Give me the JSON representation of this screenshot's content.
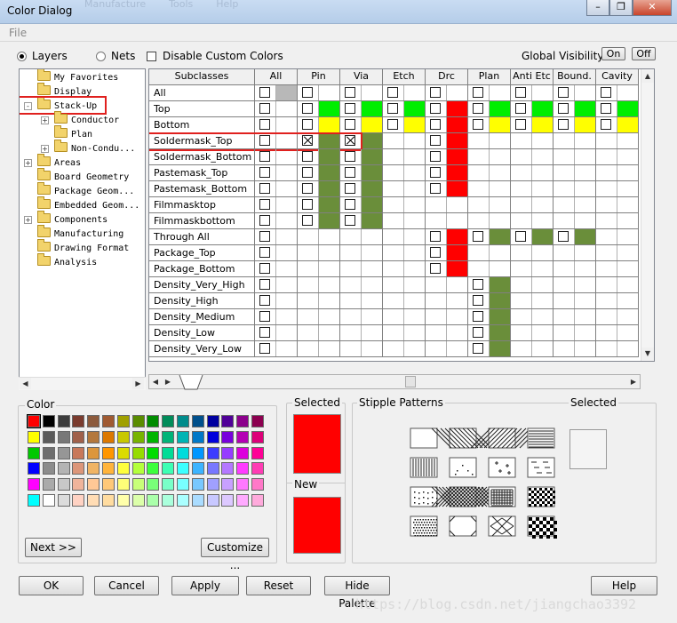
{
  "window": {
    "title": "Color Dialog",
    "ghost_menu": [
      "Manufacture",
      "Tools",
      "Help"
    ],
    "controls": [
      "minimize-icon",
      "restore-icon",
      "close-icon"
    ]
  },
  "menu": {
    "file": "File"
  },
  "options": {
    "layers_label": "Layers",
    "layers_selected": true,
    "nets_label": "Nets",
    "nets_selected": false,
    "disable_custom_label": "Disable Custom Colors",
    "disable_custom_checked": false,
    "global_visibility_label": "Global Visibility:",
    "on_label": "On",
    "off_label": "Off"
  },
  "tree": [
    {
      "label": "My Favorites",
      "level": 0,
      "expander": "",
      "highlighted": false
    },
    {
      "label": "Display",
      "level": 0,
      "expander": "",
      "highlighted": false
    },
    {
      "label": "Stack-Up",
      "level": 0,
      "expander": "-",
      "highlighted": true
    },
    {
      "label": "Conductor",
      "level": 1,
      "expander": "+",
      "highlighted": false
    },
    {
      "label": "Plan",
      "level": 1,
      "expander": "",
      "highlighted": false
    },
    {
      "label": "Non-Condu...",
      "level": 1,
      "expander": "+",
      "highlighted": false
    },
    {
      "label": "Areas",
      "level": 0,
      "expander": "+",
      "highlighted": false
    },
    {
      "label": "Board Geometry",
      "level": 0,
      "expander": "",
      "highlighted": false
    },
    {
      "label": "Package Geom...",
      "level": 0,
      "expander": "",
      "highlighted": false
    },
    {
      "label": "Embedded Geom...",
      "level": 0,
      "expander": "",
      "highlighted": false
    },
    {
      "label": "Components",
      "level": 0,
      "expander": "+",
      "highlighted": false
    },
    {
      "label": "Manufacturing",
      "level": 0,
      "expander": "",
      "highlighted": false
    },
    {
      "label": "Drawing Format",
      "level": 0,
      "expander": "",
      "highlighted": false
    },
    {
      "label": "Analysis",
      "level": 0,
      "expander": "",
      "highlighted": false
    }
  ],
  "grid": {
    "subclass_header": "Subclasses",
    "columns": [
      "All",
      "Pin",
      "Via",
      "Etch",
      "Drc",
      "Plan",
      "Anti Etc",
      "Bound.",
      "Cavity"
    ],
    "highlighted_row": "Soldermask_Top",
    "rows": [
      {
        "name": "All",
        "cells": [
          {
            "chk": true,
            "color": "#b8b8b8"
          },
          {
            "chk": true,
            "color": ""
          },
          {
            "chk": true,
            "color": ""
          },
          {
            "chk": true,
            "color": ""
          },
          {
            "chk": true,
            "color": ""
          },
          {
            "chk": true,
            "color": ""
          },
          {
            "chk": true,
            "color": ""
          },
          {
            "chk": true,
            "color": ""
          },
          {
            "chk": true,
            "color": ""
          }
        ]
      },
      {
        "name": "Top",
        "cells": [
          {
            "chk": true,
            "color": ""
          },
          {
            "chk": true,
            "color": "#00ee00"
          },
          {
            "chk": true,
            "color": "#00ee00"
          },
          {
            "chk": true,
            "color": "#00ee00"
          },
          {
            "chk": true,
            "color": "#ff0000"
          },
          {
            "chk": true,
            "color": "#00ee00"
          },
          {
            "chk": true,
            "color": "#00ee00"
          },
          {
            "chk": true,
            "color": "#00ee00"
          },
          {
            "chk": true,
            "color": "#00ee00"
          }
        ]
      },
      {
        "name": "Bottom",
        "cells": [
          {
            "chk": true,
            "color": ""
          },
          {
            "chk": true,
            "color": "#ffff00"
          },
          {
            "chk": true,
            "color": "#ffff00"
          },
          {
            "chk": true,
            "color": "#ffff00"
          },
          {
            "chk": true,
            "color": "#ff0000"
          },
          {
            "chk": true,
            "color": "#ffff00"
          },
          {
            "chk": true,
            "color": "#ffff00"
          },
          {
            "chk": true,
            "color": "#ffff00"
          },
          {
            "chk": true,
            "color": "#ffff00"
          }
        ]
      },
      {
        "name": "Soldermask_Top",
        "cells": [
          {
            "chk": true,
            "color": ""
          },
          {
            "chk": "x",
            "color": "#6a8e3a"
          },
          {
            "chk": "x",
            "color": "#6a8e3a"
          },
          {
            "chk": false,
            "color": ""
          },
          {
            "chk": true,
            "color": "#ff0000"
          },
          {
            "chk": false,
            "color": ""
          },
          {
            "chk": false,
            "color": ""
          },
          {
            "chk": false,
            "color": ""
          },
          {
            "chk": false,
            "color": ""
          }
        ]
      },
      {
        "name": "Soldermask_Bottom",
        "cells": [
          {
            "chk": true,
            "color": ""
          },
          {
            "chk": true,
            "color": "#6a8e3a"
          },
          {
            "chk": true,
            "color": "#6a8e3a"
          },
          {
            "chk": false,
            "color": ""
          },
          {
            "chk": true,
            "color": "#ff0000"
          },
          {
            "chk": false,
            "color": ""
          },
          {
            "chk": false,
            "color": ""
          },
          {
            "chk": false,
            "color": ""
          },
          {
            "chk": false,
            "color": ""
          }
        ]
      },
      {
        "name": "Pastemask_Top",
        "cells": [
          {
            "chk": true,
            "color": ""
          },
          {
            "chk": true,
            "color": "#6a8e3a"
          },
          {
            "chk": true,
            "color": "#6a8e3a"
          },
          {
            "chk": false,
            "color": ""
          },
          {
            "chk": true,
            "color": "#ff0000"
          },
          {
            "chk": false,
            "color": ""
          },
          {
            "chk": false,
            "color": ""
          },
          {
            "chk": false,
            "color": ""
          },
          {
            "chk": false,
            "color": ""
          }
        ]
      },
      {
        "name": "Pastemask_Bottom",
        "cells": [
          {
            "chk": true,
            "color": ""
          },
          {
            "chk": true,
            "color": "#6a8e3a"
          },
          {
            "chk": true,
            "color": "#6a8e3a"
          },
          {
            "chk": false,
            "color": ""
          },
          {
            "chk": true,
            "color": "#ff0000"
          },
          {
            "chk": false,
            "color": ""
          },
          {
            "chk": false,
            "color": ""
          },
          {
            "chk": false,
            "color": ""
          },
          {
            "chk": false,
            "color": ""
          }
        ]
      },
      {
        "name": "Filmmasktop",
        "cells": [
          {
            "chk": true,
            "color": ""
          },
          {
            "chk": true,
            "color": "#6a8e3a"
          },
          {
            "chk": true,
            "color": "#6a8e3a"
          },
          {
            "chk": false,
            "color": ""
          },
          {
            "chk": false,
            "color": ""
          },
          {
            "chk": false,
            "color": ""
          },
          {
            "chk": false,
            "color": ""
          },
          {
            "chk": false,
            "color": ""
          },
          {
            "chk": false,
            "color": ""
          }
        ]
      },
      {
        "name": "Filmmaskbottom",
        "cells": [
          {
            "chk": true,
            "color": ""
          },
          {
            "chk": true,
            "color": "#6a8e3a"
          },
          {
            "chk": true,
            "color": "#6a8e3a"
          },
          {
            "chk": false,
            "color": ""
          },
          {
            "chk": false,
            "color": ""
          },
          {
            "chk": false,
            "color": ""
          },
          {
            "chk": false,
            "color": ""
          },
          {
            "chk": false,
            "color": ""
          },
          {
            "chk": false,
            "color": ""
          }
        ]
      },
      {
        "name": "Through All",
        "cells": [
          {
            "chk": true,
            "color": ""
          },
          {
            "chk": false,
            "color": ""
          },
          {
            "chk": false,
            "color": ""
          },
          {
            "chk": false,
            "color": ""
          },
          {
            "chk": true,
            "color": "#ff0000"
          },
          {
            "chk": true,
            "color": "#6a8e3a"
          },
          {
            "chk": true,
            "color": "#6a8e3a"
          },
          {
            "chk": true,
            "color": "#6a8e3a"
          },
          {
            "chk": false,
            "color": ""
          }
        ]
      },
      {
        "name": "Package_Top",
        "cells": [
          {
            "chk": true,
            "color": ""
          },
          {
            "chk": false,
            "color": ""
          },
          {
            "chk": false,
            "color": ""
          },
          {
            "chk": false,
            "color": ""
          },
          {
            "chk": true,
            "color": "#ff0000"
          },
          {
            "chk": false,
            "color": ""
          },
          {
            "chk": false,
            "color": ""
          },
          {
            "chk": false,
            "color": ""
          },
          {
            "chk": false,
            "color": ""
          }
        ]
      },
      {
        "name": "Package_Bottom",
        "cells": [
          {
            "chk": true,
            "color": ""
          },
          {
            "chk": false,
            "color": ""
          },
          {
            "chk": false,
            "color": ""
          },
          {
            "chk": false,
            "color": ""
          },
          {
            "chk": true,
            "color": "#ff0000"
          },
          {
            "chk": false,
            "color": ""
          },
          {
            "chk": false,
            "color": ""
          },
          {
            "chk": false,
            "color": ""
          },
          {
            "chk": false,
            "color": ""
          }
        ]
      },
      {
        "name": "Density_Very_High",
        "cells": [
          {
            "chk": true,
            "color": ""
          },
          {
            "chk": false,
            "color": ""
          },
          {
            "chk": false,
            "color": ""
          },
          {
            "chk": false,
            "color": ""
          },
          {
            "chk": false,
            "color": ""
          },
          {
            "chk": true,
            "color": "#6a8e3a"
          },
          {
            "chk": false,
            "color": ""
          },
          {
            "chk": false,
            "color": ""
          },
          {
            "chk": false,
            "color": ""
          }
        ]
      },
      {
        "name": "Density_High",
        "cells": [
          {
            "chk": true,
            "color": ""
          },
          {
            "chk": false,
            "color": ""
          },
          {
            "chk": false,
            "color": ""
          },
          {
            "chk": false,
            "color": ""
          },
          {
            "chk": false,
            "color": ""
          },
          {
            "chk": true,
            "color": "#6a8e3a"
          },
          {
            "chk": false,
            "color": ""
          },
          {
            "chk": false,
            "color": ""
          },
          {
            "chk": false,
            "color": ""
          }
        ]
      },
      {
        "name": "Density_Medium",
        "cells": [
          {
            "chk": true,
            "color": ""
          },
          {
            "chk": false,
            "color": ""
          },
          {
            "chk": false,
            "color": ""
          },
          {
            "chk": false,
            "color": ""
          },
          {
            "chk": false,
            "color": ""
          },
          {
            "chk": true,
            "color": "#6a8e3a"
          },
          {
            "chk": false,
            "color": ""
          },
          {
            "chk": false,
            "color": ""
          },
          {
            "chk": false,
            "color": ""
          }
        ]
      },
      {
        "name": "Density_Low",
        "cells": [
          {
            "chk": true,
            "color": ""
          },
          {
            "chk": false,
            "color": ""
          },
          {
            "chk": false,
            "color": ""
          },
          {
            "chk": false,
            "color": ""
          },
          {
            "chk": false,
            "color": ""
          },
          {
            "chk": true,
            "color": "#6a8e3a"
          },
          {
            "chk": false,
            "color": ""
          },
          {
            "chk": false,
            "color": ""
          },
          {
            "chk": false,
            "color": ""
          }
        ]
      },
      {
        "name": "Density_Very_Low",
        "cells": [
          {
            "chk": true,
            "color": ""
          },
          {
            "chk": false,
            "color": ""
          },
          {
            "chk": false,
            "color": ""
          },
          {
            "chk": false,
            "color": ""
          },
          {
            "chk": false,
            "color": ""
          },
          {
            "chk": true,
            "color": "#6a8e3a"
          },
          {
            "chk": false,
            "color": ""
          },
          {
            "chk": false,
            "color": ""
          },
          {
            "chk": false,
            "color": ""
          }
        ]
      }
    ]
  },
  "color_panel": {
    "title": "Color",
    "selected_index": 0,
    "palette": [
      [
        "#ff0000",
        "#000000",
        "#3c3c3c",
        "#7a3b2e",
        "#8c5a3c",
        "#a05a32",
        "#a0a000",
        "#5a8c00",
        "#008c00",
        "#008c5a",
        "#008c8c",
        "#00508c",
        "#0000a0",
        "#500098",
        "#8c008c",
        "#8c0050"
      ],
      [
        "#ffff00",
        "#5a5a5a",
        "#787878",
        "#a0604a",
        "#b4783c",
        "#dc7800",
        "#c8c800",
        "#78b400",
        "#00b400",
        "#00b478",
        "#00b4b4",
        "#0078c8",
        "#0000dc",
        "#7800dc",
        "#b400b4",
        "#dc0078"
      ],
      [
        "#00c800",
        "#6e6e6e",
        "#969696",
        "#c8785a",
        "#dc963c",
        "#ff9600",
        "#dcdc00",
        "#96dc00",
        "#00dc00",
        "#00dc96",
        "#00dcdc",
        "#0096ff",
        "#3c3cff",
        "#963cff",
        "#dc00dc",
        "#ff0096"
      ],
      [
        "#0000ff",
        "#8c8c8c",
        "#b4b4b4",
        "#dc967a",
        "#f0b464",
        "#ffb43c",
        "#ffff3c",
        "#b4ff3c",
        "#3cff3c",
        "#3cffb4",
        "#3cffff",
        "#3cb4ff",
        "#7878ff",
        "#b478ff",
        "#ff3cff",
        "#ff3cb4"
      ],
      [
        "#ff00ff",
        "#aaaaaa",
        "#c8c8c8",
        "#f0b49b",
        "#ffc896",
        "#ffc878",
        "#ffff78",
        "#c8ff78",
        "#78ff78",
        "#78ffc8",
        "#78ffff",
        "#78c8ff",
        "#a0a0ff",
        "#c8a0ff",
        "#ff78ff",
        "#ff78c8"
      ],
      [
        "#00ffff",
        "#ffffff",
        "#dcdcdc",
        "#ffd2c3",
        "#ffdcb4",
        "#ffdca0",
        "#ffffaa",
        "#dcffaa",
        "#aaffaa",
        "#aaffdc",
        "#aaffff",
        "#aadcff",
        "#c8c8ff",
        "#dcc8ff",
        "#ffaaff",
        "#ffaadc"
      ]
    ],
    "next_label": "Next >>",
    "customize_label": "Customize ..."
  },
  "preview": {
    "selected_label": "Selected",
    "selected_color": "#ff0000",
    "new_label": "New",
    "new_color": "#ff0000"
  },
  "stipple": {
    "title": "Stipple Patterns",
    "selected_label": "Selected",
    "patterns": [
      "solid",
      "diag-back",
      "diag-fwd",
      "horiz",
      "vert",
      "dots-sparse",
      "plus-sparse",
      "dash",
      "dots-rows",
      "crosshatch-diag",
      "grid",
      "dense-checker",
      "dense-dots",
      "octagon",
      "x-diamond",
      "checker"
    ]
  },
  "buttons": {
    "ok": "OK",
    "cancel": "Cancel",
    "apply": "Apply",
    "reset": "Reset",
    "hide_palette": "Hide Palette",
    "help": "Help"
  },
  "watermark": "https://blog.csdn.net/jiangchao3392"
}
